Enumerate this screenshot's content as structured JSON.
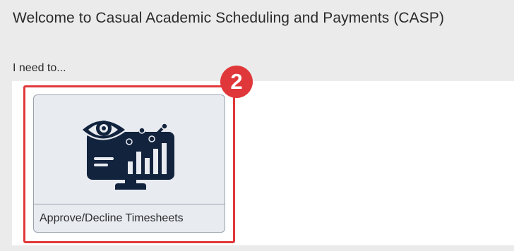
{
  "header": {
    "title": "Welcome to Casual Academic Scheduling and Payments (CASP)"
  },
  "intro": {
    "label": "I need to..."
  },
  "tiles": [
    {
      "label": "Approve/Decline Timesheets",
      "icon": "monitor-eye-chart-icon"
    }
  ],
  "annotation": {
    "step_number": "2",
    "color": "#e0383a"
  },
  "colors": {
    "icon": "#12233d",
    "tile_background": "#e8ebf0",
    "page_background": "#ebebeb"
  }
}
